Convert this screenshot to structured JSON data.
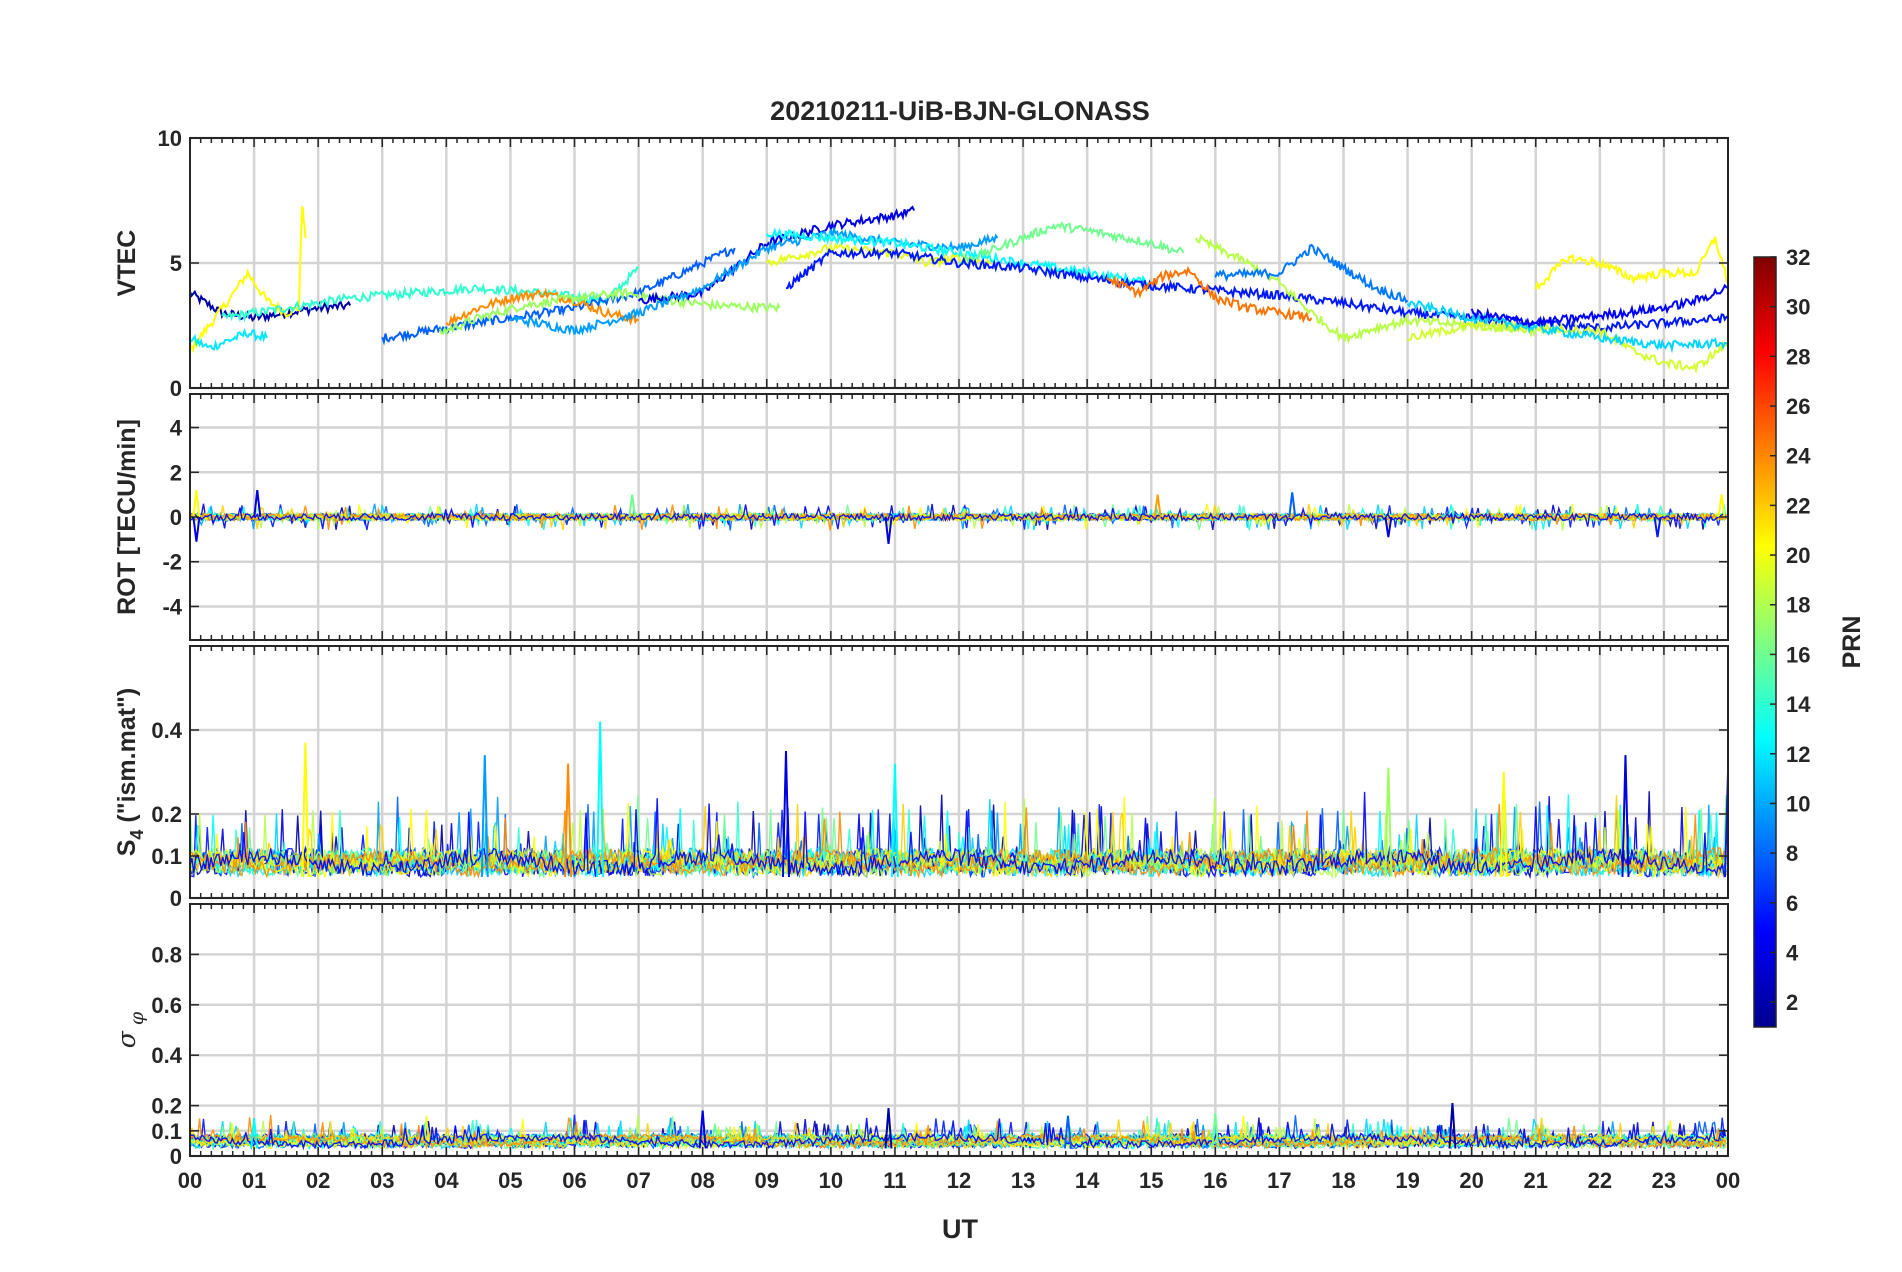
{
  "chart_data": {
    "type": "line",
    "title": "20210211-UiB-BJN-GLONASS",
    "xlabel": "UT",
    "x_tick_labels": [
      "00",
      "01",
      "02",
      "03",
      "04",
      "05",
      "06",
      "07",
      "08",
      "09",
      "10",
      "11",
      "12",
      "13",
      "14",
      "15",
      "16",
      "17",
      "18",
      "19",
      "20",
      "21",
      "22",
      "23",
      "00"
    ],
    "xlim_hours": [
      0,
      24
    ],
    "grid": true,
    "colorbar": {
      "label": "PRN",
      "range": [
        1,
        32
      ],
      "tick_labels": [
        "2",
        "4",
        "6",
        "8",
        "10",
        "12",
        "14",
        "16",
        "18",
        "20",
        "22",
        "24",
        "26",
        "28",
        "30",
        "32"
      ],
      "colormap": "jet"
    },
    "panels": [
      {
        "ylabel": "VTEC",
        "ylim": [
          0,
          10
        ],
        "yticks": [
          0,
          5,
          10
        ],
        "ytick_labels": [
          "0",
          "5",
          "10"
        ],
        "series": [
          {
            "prn": 2,
            "color": "#0000a8",
            "x": [
              0,
              0.5,
              1,
              1.5,
              2,
              2.5
            ],
            "y": [
              3.8,
              3.0,
              2.8,
              3.0,
              3.2,
              3.3
            ]
          },
          {
            "prn": 20,
            "color": "#ffff00",
            "x": [
              0,
              0.3,
              0.6,
              0.9,
              1.2,
              1.5,
              1.7,
              1.75,
              1.8
            ],
            "y": [
              1.5,
              2.5,
              3.5,
              4.6,
              3.5,
              3.0,
              3.2,
              7.4,
              6.0
            ]
          },
          {
            "prn": 12,
            "color": "#00e8ff",
            "x": [
              0,
              0.3,
              0.6,
              0.9,
              1.2
            ],
            "y": [
              2.0,
              1.6,
              1.9,
              2.2,
              2.0
            ]
          },
          {
            "prn": 15,
            "color": "#30ffcf",
            "x": [
              0.5,
              1.5,
              2.5,
              3.5,
              4.5,
              5.5,
              6.5,
              7
            ],
            "y": [
              2.8,
              3.2,
              3.6,
              3.8,
              4.0,
              3.8,
              3.5,
              4.8
            ]
          },
          {
            "prn": 8,
            "color": "#0060ff",
            "x": [
              3,
              4,
              5,
              6,
              7,
              8,
              8.5
            ],
            "y": [
              2.0,
              2.4,
              2.8,
              3.2,
              3.8,
              5.0,
              5.6
            ]
          },
          {
            "prn": 24,
            "color": "#ff8c00",
            "x": [
              4,
              4.5,
              5,
              5.5,
              6,
              6.5,
              7.0
            ],
            "y": [
              2.6,
              3.2,
              3.6,
              3.8,
              3.5,
              3.0,
              2.7
            ]
          },
          {
            "prn": 17,
            "color": "#9cff5f",
            "x": [
              3.9,
              4.5,
              5.2,
              6,
              6.8,
              7.5,
              8.2,
              9.2
            ],
            "y": [
              2.2,
              2.8,
              3.3,
              3.6,
              3.8,
              3.5,
              3.3,
              3.2
            ]
          },
          {
            "prn": 3,
            "color": "#0000e0",
            "x": [
              7,
              8,
              9,
              10,
              11,
              11.3
            ],
            "y": [
              3.5,
              3.8,
              5.8,
              6.5,
              6.9,
              7.1
            ]
          },
          {
            "prn": 10,
            "color": "#009cff",
            "x": [
              5,
              6,
              7,
              8,
              9,
              10,
              11,
              12,
              12.6
            ],
            "y": [
              2.8,
              2.3,
              3.0,
              4.0,
              5.6,
              6.2,
              5.8,
              5.6,
              6.0
            ]
          },
          {
            "prn": 13,
            "color": "#00ffff",
            "x": [
              9,
              10,
              11,
              12,
              13,
              14,
              15
            ],
            "y": [
              6.2,
              6.0,
              5.8,
              5.4,
              5.0,
              4.6,
              4.2
            ]
          },
          {
            "prn": 19,
            "color": "#e8ff16",
            "x": [
              9,
              10,
              11,
              11.5,
              12,
              12.5
            ],
            "y": [
              5.0,
              5.6,
              5.4,
              5.0,
              5.2,
              5.0
            ]
          },
          {
            "prn": 16,
            "color": "#70ff8f",
            "x": [
              12,
              13,
              13.5,
              14,
              15,
              15.5
            ],
            "y": [
              5.0,
              6.0,
              6.5,
              6.3,
              5.8,
              5.4
            ]
          },
          {
            "prn": 5,
            "color": "#0018ff",
            "x": [
              9.3,
              10,
              11,
              12,
              13,
              14,
              15,
              16,
              17,
              18,
              19,
              20,
              21,
              22,
              23,
              24
            ],
            "y": [
              4.0,
              5.4,
              5.4,
              5.0,
              4.8,
              4.4,
              4.1,
              3.9,
              3.7,
              3.4,
              3.0,
              2.8,
              2.6,
              2.4,
              2.6,
              2.8
            ]
          },
          {
            "prn": 25,
            "color": "#ff7400",
            "x": [
              14.3,
              14.8,
              15.2,
              15.6,
              16,
              16.5,
              17,
              17.5
            ],
            "y": [
              4.4,
              3.8,
              4.5,
              4.7,
              3.6,
              3.2,
              3.0,
              2.8
            ]
          },
          {
            "prn": 17,
            "color": "#b8ff48",
            "x": [
              15.7,
              16.5,
              17,
              17.5,
              18,
              18.5,
              19,
              20,
              21
            ],
            "y": [
              6.0,
              5.0,
              4.2,
              3.0,
              2.0,
              2.4,
              2.7,
              2.5,
              2.3
            ]
          },
          {
            "prn": 9,
            "color": "#0078ff",
            "x": [
              16,
              17,
              17.5,
              18,
              18.5,
              19
            ],
            "y": [
              4.5,
              4.6,
              5.6,
              4.8,
              4.0,
              3.5
            ]
          },
          {
            "prn": 18,
            "color": "#d4ff2f",
            "x": [
              19,
              20,
              21,
              22,
              22.5,
              23,
              23.5,
              24
            ],
            "y": [
              2.0,
              2.5,
              2.4,
              2.3,
              1.5,
              1.0,
              0.8,
              1.8
            ]
          },
          {
            "prn": 20,
            "color": "#ffff00",
            "x": [
              21,
              21.5,
              22,
              22.5,
              23,
              23.5,
              23.8,
              24
            ],
            "y": [
              4.0,
              5.2,
              5.0,
              4.4,
              4.6,
              4.6,
              6.0,
              4.2
            ]
          },
          {
            "prn": 12,
            "color": "#00d4ff",
            "x": [
              19,
              20,
              21,
              22,
              23,
              24
            ],
            "y": [
              3.4,
              2.8,
              2.4,
              2.0,
              1.7,
              1.8
            ]
          },
          {
            "prn": 4,
            "color": "#0000ff",
            "x": [
              20,
              21,
              22,
              23,
              23.5,
              24
            ],
            "y": [
              3.0,
              2.6,
              2.9,
              3.2,
              3.5,
              4.0
            ]
          }
        ]
      },
      {
        "ylabel": "ROT [TECU/min]",
        "ylim": [
          -5.5,
          5.5
        ],
        "yticks": [
          -4,
          -2,
          0,
          2,
          4
        ],
        "ytick_labels": [
          "-4",
          "-2",
          "0",
          "2",
          "4"
        ],
        "baseline": 0,
        "noise_amplitude": 0.15,
        "spikes": [
          {
            "x": 0.1,
            "y": 1.2,
            "color": "#ffff00"
          },
          {
            "x": 0.1,
            "y": -1.1,
            "color": "#0000e0"
          },
          {
            "x": 1.05,
            "y": 1.2,
            "color": "#0000e0"
          },
          {
            "x": 6.9,
            "y": 1.0,
            "color": "#70ff8f"
          },
          {
            "x": 10.9,
            "y": -1.2,
            "color": "#0000e0"
          },
          {
            "x": 15.1,
            "y": 1.0,
            "color": "#ffa000"
          },
          {
            "x": 17.2,
            "y": 1.1,
            "color": "#0060ff"
          },
          {
            "x": 18.7,
            "y": -0.9,
            "color": "#0000e0"
          },
          {
            "x": 23.9,
            "y": 1.0,
            "color": "#ffff00"
          },
          {
            "x": 22.9,
            "y": -0.9,
            "color": "#0018ff"
          }
        ]
      },
      {
        "ylabel": "S4 (\"ism.mat\")",
        "ylim": [
          0,
          0.6
        ],
        "yticks": [
          0,
          0.1,
          0.2,
          0.4
        ],
        "ytick_labels": [
          "0",
          "0.1",
          "0.2",
          "0.4"
        ],
        "baseline": 0.05,
        "spikes": [
          {
            "x": 6.4,
            "y": 0.42,
            "color": "#00ffff"
          },
          {
            "x": 9.3,
            "y": 0.35,
            "color": "#0000e0"
          },
          {
            "x": 1.8,
            "y": 0.37,
            "color": "#ffff00"
          },
          {
            "x": 4.6,
            "y": 0.34,
            "color": "#009cff"
          },
          {
            "x": 22.4,
            "y": 0.34,
            "color": "#0000e0"
          },
          {
            "x": 5.9,
            "y": 0.32,
            "color": "#ff8c00"
          },
          {
            "x": 11.0,
            "y": 0.32,
            "color": "#00ffff"
          },
          {
            "x": 18.7,
            "y": 0.31,
            "color": "#9cff5f"
          },
          {
            "x": 24.0,
            "y": 0.3,
            "color": "#0018ff"
          },
          {
            "x": 20.5,
            "y": 0.3,
            "color": "#ffff00"
          }
        ]
      },
      {
        "ylabel": "σ φ",
        "ylim": [
          0,
          1
        ],
        "yticks": [
          0,
          0.1,
          0.2,
          0.4,
          0.6,
          0.8
        ],
        "ytick_labels": [
          "0",
          "0.1",
          "0.2",
          "0.4",
          "0.6",
          "0.8"
        ],
        "baseline": 0.03,
        "spikes": [
          {
            "x": 19.7,
            "y": 0.21,
            "color": "#0000a8"
          },
          {
            "x": 8.0,
            "y": 0.18,
            "color": "#0000e0"
          },
          {
            "x": 10.9,
            "y": 0.19,
            "color": "#0000a8"
          },
          {
            "x": 1.0,
            "y": 0.15,
            "color": "#00ffff"
          },
          {
            "x": 13.7,
            "y": 0.16,
            "color": "#0060ff"
          },
          {
            "x": 16.0,
            "y": 0.17,
            "color": "#70ff8f"
          }
        ]
      }
    ]
  }
}
